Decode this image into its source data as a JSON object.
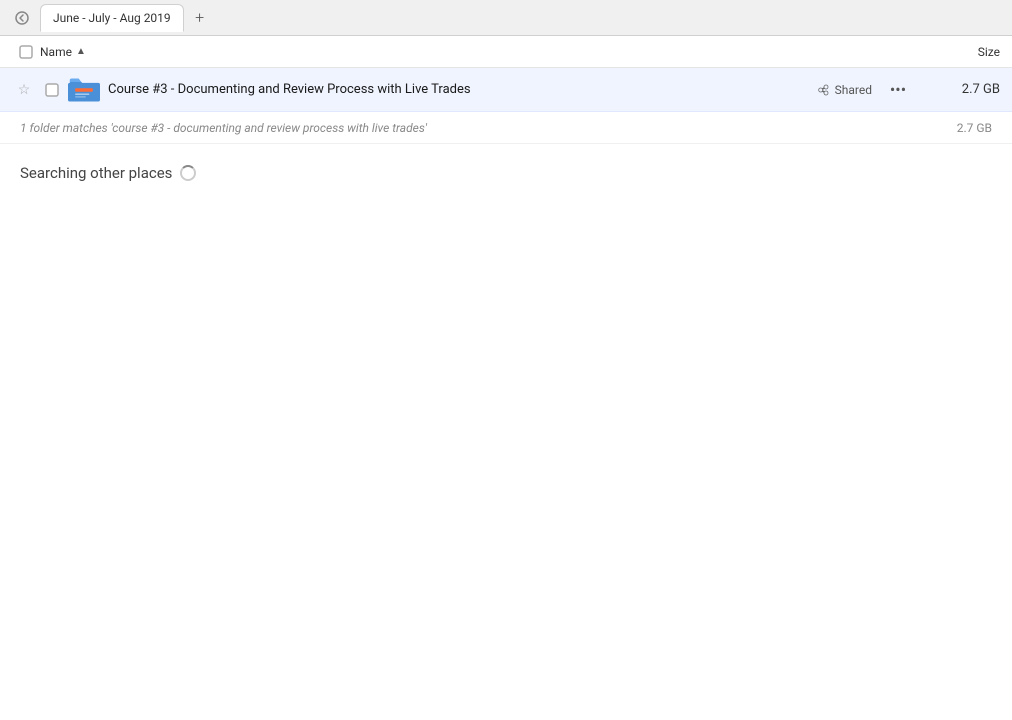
{
  "tabBar": {
    "backIcon": "←",
    "tab": {
      "label": "June - July - Aug 2019"
    },
    "addTabIcon": "+"
  },
  "columnHeader": {
    "checkboxLabel": "",
    "nameLabel": "Name",
    "sortArrow": "▲",
    "sizeLabel": "Size"
  },
  "fileRow": {
    "starIcon": "☆",
    "folderName": "Course #3 - Documenting and Review Process with Live Trades",
    "sharedLabel": "Shared",
    "moreIcon": "•••",
    "fileSize": "2.7 GB"
  },
  "matchRow": {
    "matchText": "1 folder matches 'course #3 - documenting and review process with live trades'",
    "matchSize": "2.7 GB"
  },
  "searchingSection": {
    "text": "Searching other places"
  }
}
